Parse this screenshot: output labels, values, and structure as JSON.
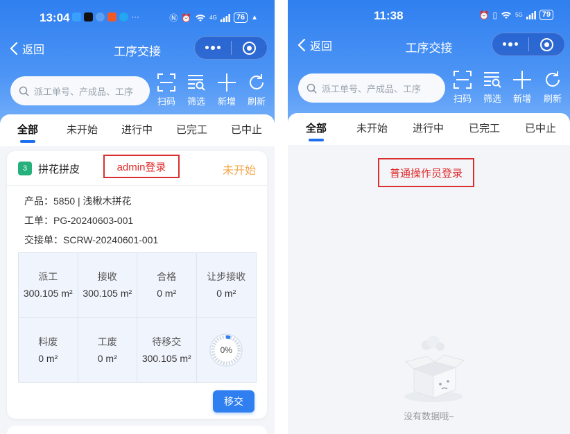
{
  "left": {
    "status_bar": {
      "time": "13:04",
      "network": "4G",
      "battery": "76"
    },
    "nav": {
      "back_label": "返回",
      "title": "工序交接"
    },
    "search": {
      "placeholder": "派工单号、产成品、工序"
    },
    "tools": [
      {
        "label": "扫码",
        "icon": "scan-icon"
      },
      {
        "label": "筛选",
        "icon": "filter-icon"
      },
      {
        "label": "新增",
        "icon": "plus-icon"
      },
      {
        "label": "刷新",
        "icon": "refresh-icon"
      }
    ],
    "tabs": [
      "全部",
      "未开始",
      "进行中",
      "已完工",
      "已中止"
    ],
    "active_tab": "全部",
    "annotation": "admin登录",
    "card": {
      "index": "3",
      "process": "拼花拼皮",
      "status": "未开始",
      "product": "产品：5850 | 浅楸木拼花",
      "work_order": "工单：PG-20240603-001",
      "handover_no": "交接单：SCRW-20240601-001",
      "stats": [
        {
          "label": "派工",
          "value": "300.105 m²"
        },
        {
          "label": "接收",
          "value": "300.105 m²"
        },
        {
          "label": "合格",
          "value": "0 m²"
        },
        {
          "label": "让步接收",
          "value": "0 m²"
        },
        {
          "label": "料废",
          "value": "0 m²"
        },
        {
          "label": "工废",
          "value": "0 m²"
        },
        {
          "label": "待移交",
          "value": "300.105 m²"
        }
      ],
      "progress_text": "0%",
      "progress": 0,
      "move_button": "移交"
    }
  },
  "right": {
    "status_bar": {
      "time": "11:38",
      "network": "5G",
      "battery": "79"
    },
    "nav": {
      "back_label": "返回",
      "title": "工序交接"
    },
    "search": {
      "placeholder": "派工单号、产成品、工序"
    },
    "tools": [
      {
        "label": "扫码",
        "icon": "scan-icon"
      },
      {
        "label": "筛选",
        "icon": "filter-icon"
      },
      {
        "label": "新增",
        "icon": "plus-icon"
      },
      {
        "label": "刷新",
        "icon": "refresh-icon"
      }
    ],
    "tabs": [
      "全部",
      "未开始",
      "进行中",
      "已完工",
      "已中止"
    ],
    "active_tab": "全部",
    "annotation": "普通操作员登录",
    "empty_text": "没有数据哦~"
  },
  "colors": {
    "primary": "#2f7ff0",
    "pending": "#f3a94f",
    "annotation": "#d9302f",
    "badge": "#25b07c"
  }
}
